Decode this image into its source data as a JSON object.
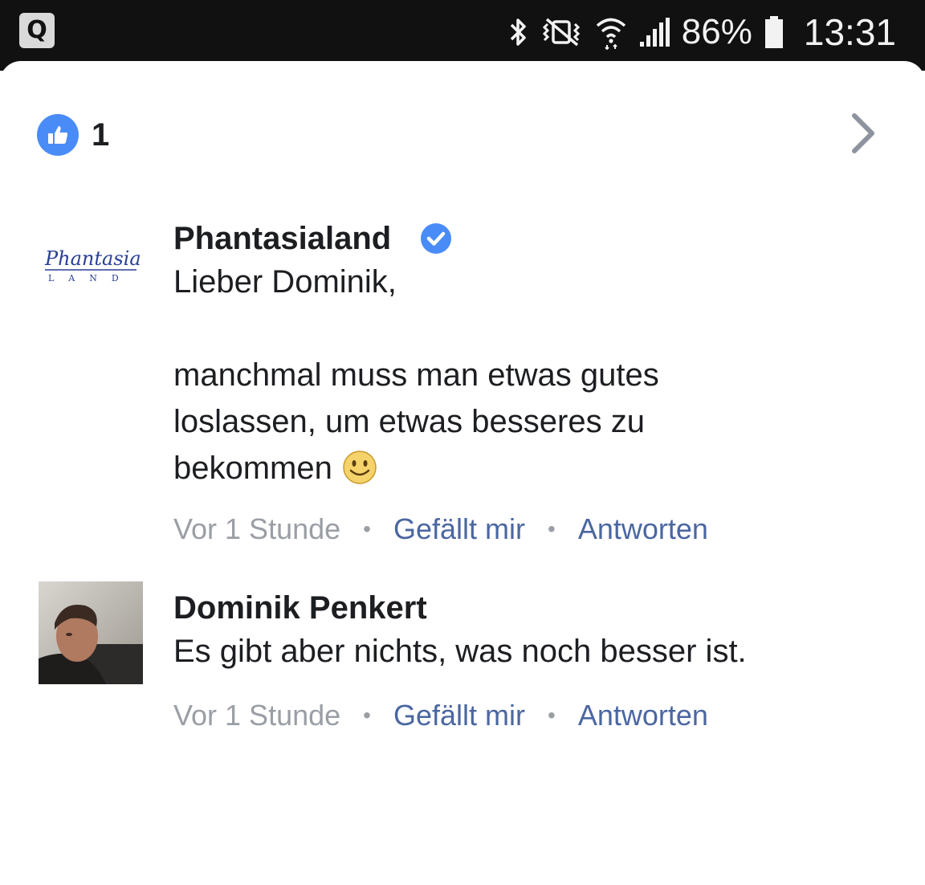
{
  "status_bar": {
    "left_icon_letter": "Q",
    "battery_percent": "86%",
    "time": "13:31",
    "icons": [
      "bluetooth-icon",
      "vibrate-mute-icon",
      "wifi-icon",
      "signal-icon",
      "battery-icon"
    ]
  },
  "reactions": {
    "icon": "thumbs-up-icon",
    "count": "1",
    "accent_color": "#4a8cf7"
  },
  "comments": [
    {
      "author": "Phantasialand",
      "verified": true,
      "avatar_logo_text": "Phantasia LAND",
      "text": "Lieber Dominik,\n\nmanchmal muss man etwas gutes\nloslassen, um etwas besseres zu\nbekommen",
      "emoji": "smiley-emoji",
      "time": "Vor 1 Stunde",
      "like_label": "Gefällt mir",
      "reply_label": "Antworten"
    },
    {
      "author": "Dominik Penkert",
      "verified": false,
      "text": "Es gibt aber nichts, was noch besser ist.",
      "time": "Vor 1 Stunde",
      "like_label": "Gefällt mir",
      "reply_label": "Antworten"
    }
  ],
  "colors": {
    "link": "#4b67a1",
    "muted": "#9a9ea5",
    "text": "#1c1e21"
  }
}
